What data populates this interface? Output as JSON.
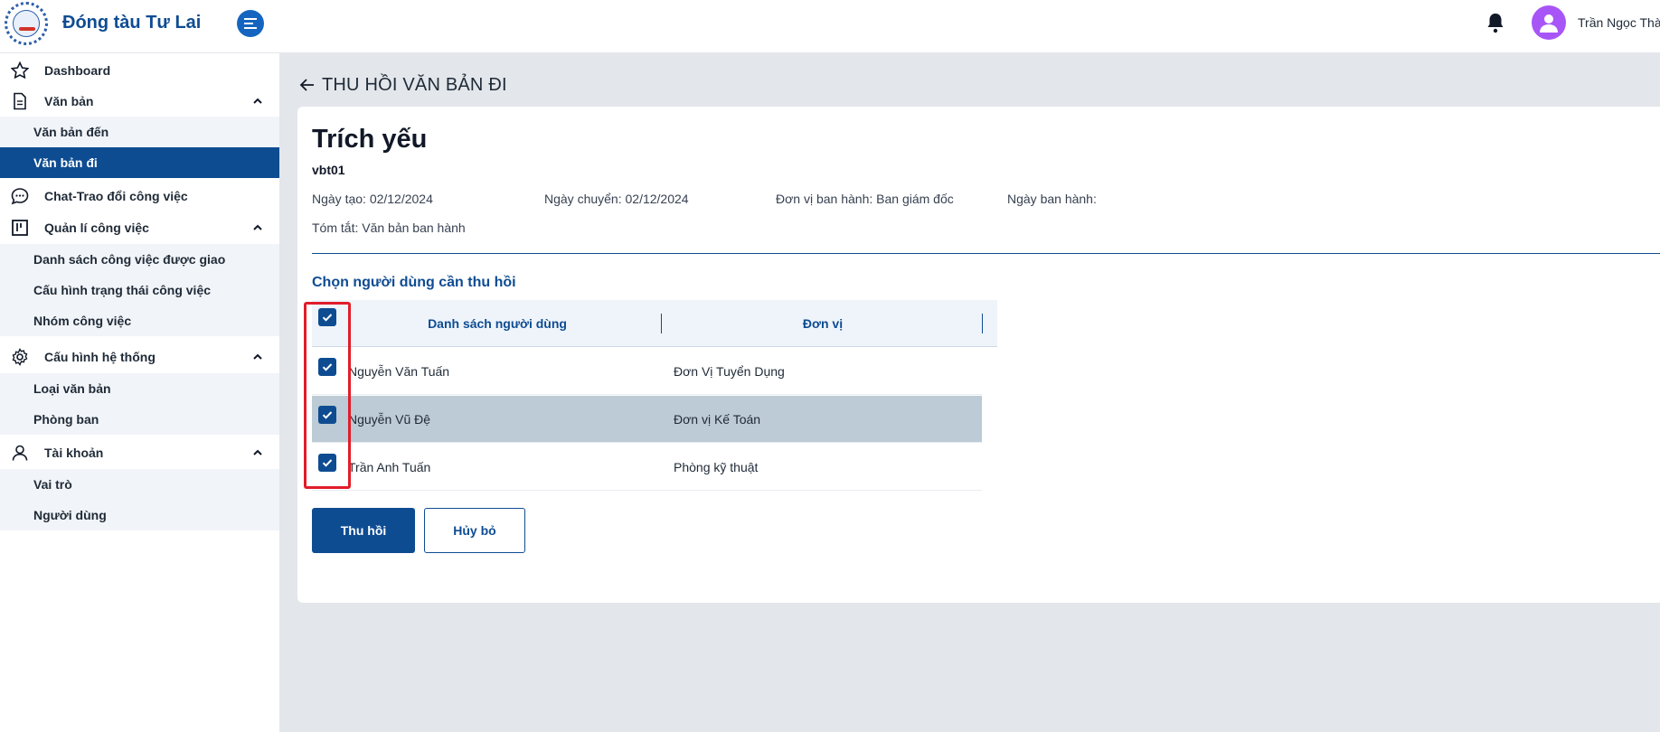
{
  "app": {
    "brand": "Đóng tàu Tư Lai",
    "user_name": "Trần Ngọc Thành"
  },
  "icons": {
    "menu": "menu-toggle-icon",
    "bell": "bell-icon",
    "avatar": "user-avatar-icon"
  },
  "colors": {
    "primary": "#0e4c92",
    "accent_button": "#1565c0",
    "avatar": "#a855f7",
    "highlight": "#e11d2a",
    "selected_row": "#bccbd5"
  },
  "sidebar": {
    "dashboard": "Dashboard",
    "van_ban": {
      "label": "Văn bản",
      "items": [
        "Văn bản đến",
        "Văn bản đi"
      ]
    },
    "chat": "Chat-Trao đổi công việc",
    "quan_li": {
      "label": "Quản lí công việc",
      "items": [
        "Danh sách công việc được giao",
        "Cấu hình trạng thái công việc",
        "Nhóm công việc"
      ]
    },
    "cau_hinh": {
      "label": "Cấu hình hệ thống",
      "items": [
        "Loại văn bản",
        "Phòng ban"
      ]
    },
    "tai_khoan": {
      "label": "Tài khoản",
      "items": [
        "Vai trò",
        "Người dùng"
      ]
    }
  },
  "page": {
    "title": "THU HỒI VĂN BẢN ĐI",
    "trich_yeu": "Trích yếu",
    "code": "vbt01",
    "ngay_tao": "Ngày tạo: 02/12/2024",
    "ngay_chuyen": "Ngày chuyển: 02/12/2024",
    "don_vi_ban_hanh": "Đơn vị ban hành: Ban giám đốc",
    "ngay_ban_hanh": "Ngày ban hành:",
    "tom_tat": "Tóm tắt: Văn bản ban hành",
    "section_title": "Chọn người dùng cần thu hồi"
  },
  "table": {
    "col_users": "Danh sách người dùng",
    "col_unit": "Đơn vị",
    "rows": [
      {
        "name": "Nguyễn Văn Tuấn",
        "unit": "Đơn Vị Tuyển Dụng",
        "checked": true
      },
      {
        "name": "Nguyễn Vũ Đệ",
        "unit": "Đơn vị Kế Toán",
        "checked": true
      },
      {
        "name": "Trần Anh Tuấn",
        "unit": "Phòng kỹ thuật",
        "checked": true
      }
    ]
  },
  "actions": {
    "submit": "Thu hồi",
    "cancel": "Hủy bỏ"
  }
}
